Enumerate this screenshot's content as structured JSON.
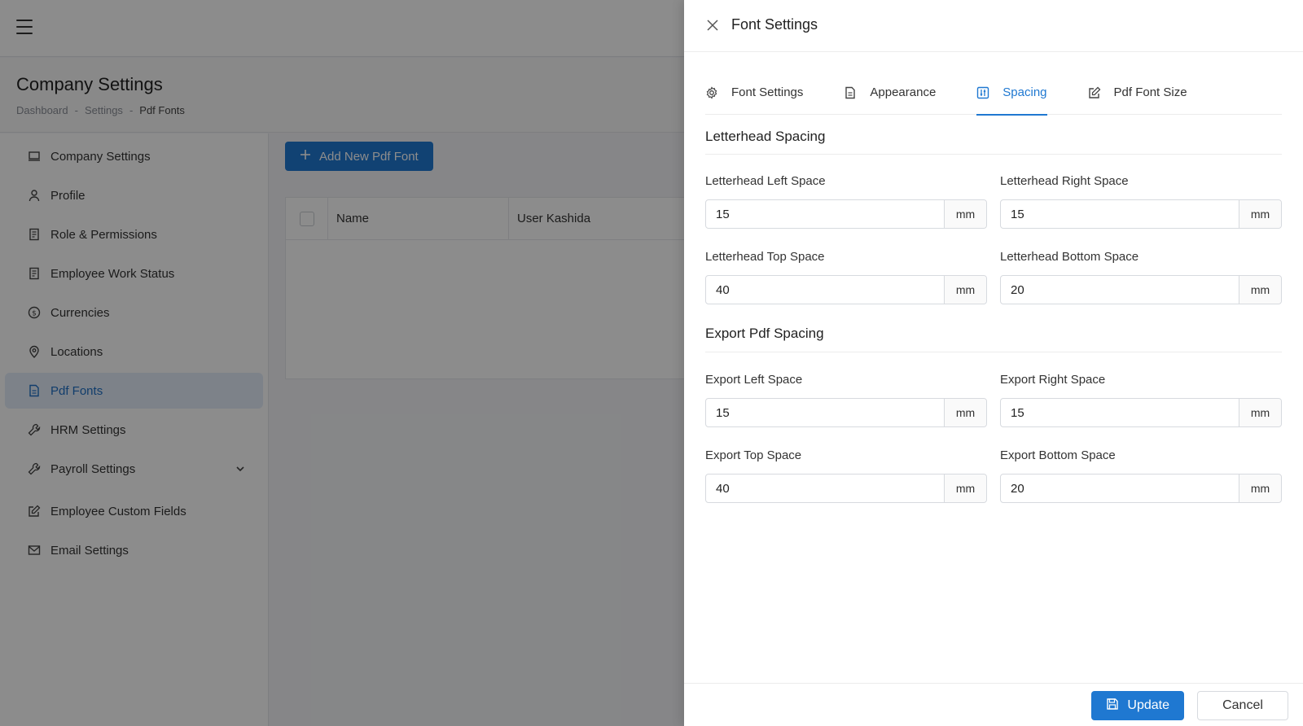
{
  "page": {
    "title": "Company Settings",
    "breadcrumb": [
      "Dashboard",
      "-",
      "Settings",
      "-",
      "Pdf Fonts"
    ]
  },
  "sidebar": {
    "items": [
      {
        "label": "Company Settings",
        "icon": "laptop-icon"
      },
      {
        "label": "Profile",
        "icon": "user-icon"
      },
      {
        "label": "Role & Permissions",
        "icon": "document-icon"
      },
      {
        "label": "Employee Work Status",
        "icon": "document-icon"
      },
      {
        "label": "Currencies",
        "icon": "dollar-icon"
      },
      {
        "label": "Locations",
        "icon": "location-icon"
      },
      {
        "label": "Pdf Fonts",
        "icon": "file-icon",
        "active": true
      },
      {
        "label": "HRM Settings",
        "icon": "wrench-icon"
      },
      {
        "label": "Payroll Settings",
        "icon": "wrench-icon"
      },
      {
        "label": "Employee Custom Fields",
        "icon": "edit-icon"
      },
      {
        "label": "Email Settings",
        "icon": "mail-icon"
      }
    ]
  },
  "content": {
    "add_button": "Add New Pdf Font",
    "columns": [
      "Name",
      "User Kashida"
    ]
  },
  "drawer": {
    "title": "Font Settings",
    "tabs": [
      {
        "label": "Font Settings",
        "icon": "gear-icon"
      },
      {
        "label": "Appearance",
        "icon": "file-icon"
      },
      {
        "label": "Spacing",
        "icon": "spacing-icon",
        "active": true
      },
      {
        "label": "Pdf Font Size",
        "icon": "edit-icon"
      }
    ],
    "letterhead": {
      "title": "Letterhead Spacing",
      "left": {
        "label": "Letterhead Left Space",
        "value": "15",
        "unit": "mm"
      },
      "right": {
        "label": "Letterhead Right Space",
        "value": "15",
        "unit": "mm"
      },
      "top": {
        "label": "Letterhead Top Space",
        "value": "40",
        "unit": "mm"
      },
      "bottom": {
        "label": "Letterhead Bottom Space",
        "value": "20",
        "unit": "mm"
      }
    },
    "export": {
      "title": "Export Pdf Spacing",
      "left": {
        "label": "Export Left Space",
        "value": "15",
        "unit": "mm"
      },
      "right": {
        "label": "Export Right Space",
        "value": "15",
        "unit": "mm"
      },
      "top": {
        "label": "Export Top Space",
        "value": "40",
        "unit": "mm"
      },
      "bottom": {
        "label": "Export Bottom Space",
        "value": "20",
        "unit": "mm"
      }
    },
    "footer": {
      "update": "Update",
      "cancel": "Cancel"
    }
  },
  "colors": {
    "primary": "#1f78d1",
    "active_bg": "#e3edf9",
    "overlay": "rgba(0,0,0,0.45)"
  }
}
